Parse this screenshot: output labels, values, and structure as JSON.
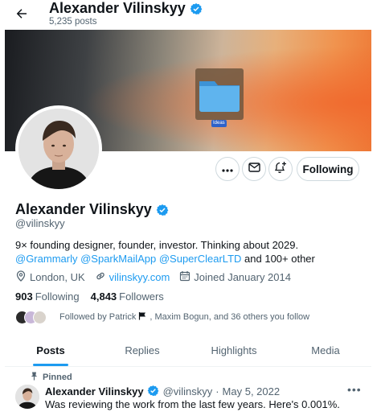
{
  "header": {
    "name": "Alexander Vilinskyy",
    "posts_count": "5,235 posts"
  },
  "banner": {
    "folder_label": "Ideas"
  },
  "actions": {
    "follow_label": "Following"
  },
  "profile": {
    "name": "Alexander Vilinskyy",
    "handle": "@vilinskyy",
    "bio_text": "9× founding designer, founder, investor. Thinking about 2029.",
    "bio_mentions": [
      "@Grammarly",
      "@SparkMailApp",
      "@SuperClearLTD"
    ],
    "bio_suffix": "and 100+ other",
    "location": "London, UK",
    "website": "vilinskyy.com",
    "joined": "Joined January 2014",
    "following_count": "903",
    "following_label": "Following",
    "followers_count": "4,843",
    "followers_label": "Followers",
    "followed_by_prefix": "Followed by Patrick",
    "followed_by_suffix": ", Maxim Bogun, and 36 others you follow"
  },
  "tabs": [
    {
      "label": "Posts",
      "active": true
    },
    {
      "label": "Replies",
      "active": false
    },
    {
      "label": "Highlights",
      "active": false
    },
    {
      "label": "Media",
      "active": false
    }
  ],
  "pinned_post": {
    "pinned_label": "Pinned",
    "author_name": "Alexander Vilinskyy",
    "author_handle": "@vilinskyy",
    "separator": "·",
    "date": "May 5, 2022",
    "text": "Was reviewing the work from the last few years. Here's 0.001%.",
    "more": "•••"
  },
  "colors": {
    "accent": "#1d9bf0",
    "text_primary": "#0f1419",
    "text_secondary": "#536471"
  },
  "icons": [
    "back-arrow-icon",
    "verified-badge-icon",
    "folder-icon",
    "more-icon",
    "mail-icon",
    "notify-plus-icon",
    "location-icon",
    "link-icon",
    "calendar-icon",
    "flag-icon",
    "pin-icon"
  ]
}
